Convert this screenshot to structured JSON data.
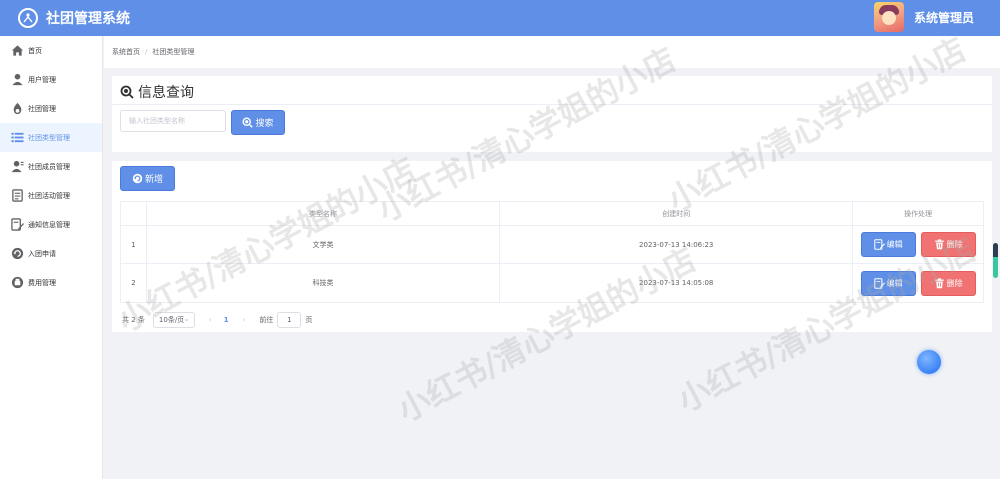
{
  "app": {
    "title": "社团管理系统",
    "user_name": "系统管理员"
  },
  "sidebar": {
    "items": [
      {
        "label": "首页",
        "icon": "home-icon",
        "active": false
      },
      {
        "label": "用户管理",
        "icon": "user-icon",
        "active": false
      },
      {
        "label": "社团管理",
        "icon": "flame-icon",
        "active": false
      },
      {
        "label": "社团类型管理",
        "icon": "list-icon",
        "active": true
      },
      {
        "label": "社团成员管理",
        "icon": "user-group-icon",
        "active": false
      },
      {
        "label": "社团活动管理",
        "icon": "document-icon",
        "active": false
      },
      {
        "label": "通知信息管理",
        "icon": "edit-document-icon",
        "active": false
      },
      {
        "label": "入团申请",
        "icon": "refresh-icon",
        "active": false
      },
      {
        "label": "费用管理",
        "icon": "wallet-icon",
        "active": false
      }
    ]
  },
  "breadcrumb": {
    "home": "系统首页",
    "separator": "/",
    "current": "社团类型管理"
  },
  "query": {
    "title": "信息查询",
    "search_placeholder": "输入社团类型名称",
    "search_value": "",
    "search_button": "搜索"
  },
  "list": {
    "add_button": "新增",
    "columns": [
      "",
      "类型名称",
      "创建时间",
      "操作处理"
    ],
    "rows": [
      {
        "index": "1",
        "name": "文学类",
        "created": "2023-07-13 14:06:23"
      },
      {
        "index": "2",
        "name": "科技类",
        "created": "2023-07-13 14:05:08"
      }
    ],
    "edit_label": "编辑",
    "delete_label": "删除"
  },
  "pagination": {
    "total_text": "共 2 条",
    "page_size": "10条/页",
    "prev": "‹",
    "current_page": "1",
    "next": "›",
    "goto_label": "前往",
    "goto_value": "1",
    "goto_suffix": "页"
  },
  "watermark": "小红书/清心学姐的小店",
  "colors": {
    "primary": "#5f8fe7",
    "danger": "#f07272",
    "header": "#5f8fe7"
  }
}
